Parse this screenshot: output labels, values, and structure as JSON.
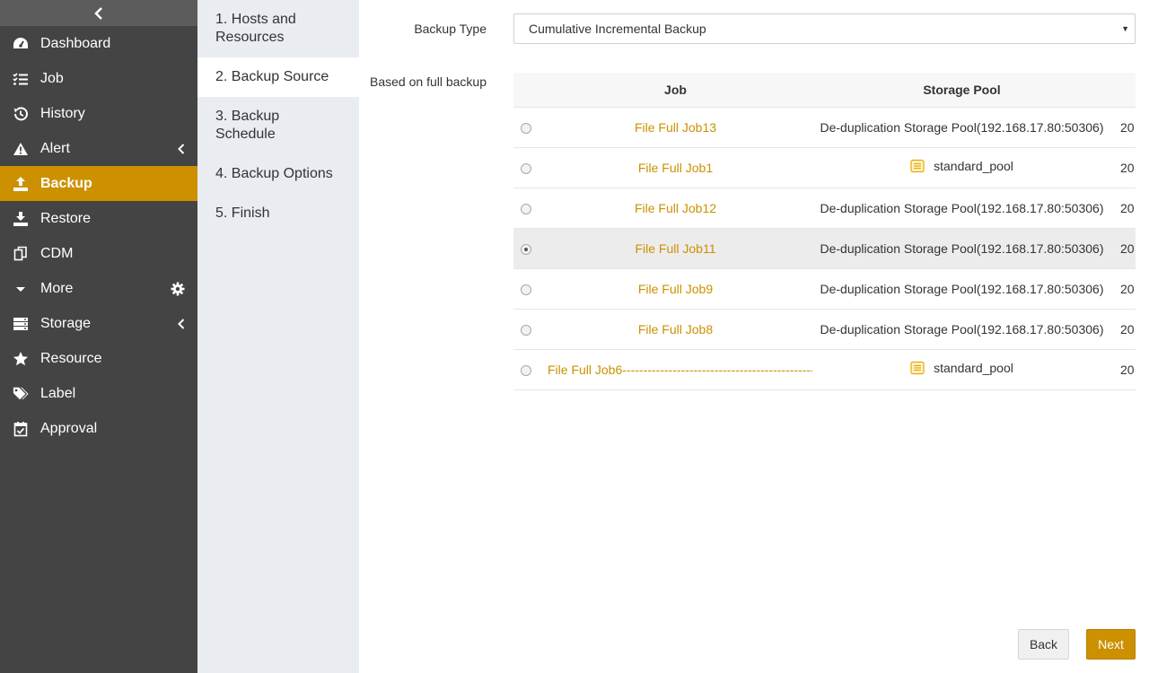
{
  "sidebar": {
    "items": [
      {
        "label": "Dashboard",
        "icon": "dashboard-icon"
      },
      {
        "label": "Job",
        "icon": "list-icon"
      },
      {
        "label": "History",
        "icon": "history-icon"
      },
      {
        "label": "Alert",
        "icon": "warning-icon"
      },
      {
        "label": "Backup",
        "icon": "upload-icon",
        "active": true
      },
      {
        "label": "Restore",
        "icon": "download-icon"
      },
      {
        "label": "CDM",
        "icon": "copy-icon"
      },
      {
        "label": "More",
        "icon": "caret-down-icon"
      },
      {
        "label": "Storage",
        "icon": "server-icon"
      },
      {
        "label": "Resource",
        "icon": "star-icon"
      },
      {
        "label": "Label",
        "icon": "tags-icon"
      },
      {
        "label": "Approval",
        "icon": "calendar-check-icon"
      }
    ]
  },
  "steps": [
    {
      "label": "1. Hosts and Resources"
    },
    {
      "label": "2. Backup Source",
      "active": true
    },
    {
      "label": "3. Backup Schedule"
    },
    {
      "label": "4. Backup Options"
    },
    {
      "label": "5. Finish"
    }
  ],
  "form": {
    "backup_type_label": "Backup Type",
    "backup_type_value": "Cumulative Incremental Backup",
    "based_on_label": "Based on full backup"
  },
  "table": {
    "headers": {
      "job": "Job",
      "pool": "Storage Pool",
      "date": ""
    },
    "rows": [
      {
        "job": "File Full Job13",
        "pool": "De-duplication Storage Pool(192.168.17.80:50306)",
        "date": "20",
        "selected": false
      },
      {
        "job": "File Full Job1",
        "pool": "standard_pool",
        "date": "20",
        "selected": false
      },
      {
        "job": "File Full Job12",
        "pool": "De-duplication Storage Pool(192.168.17.80:50306)",
        "date": "20",
        "selected": false
      },
      {
        "job": "File Full Job11",
        "pool": "De-duplication Storage Pool(192.168.17.80:50306)",
        "date": "20",
        "selected": true
      },
      {
        "job": "File Full Job9",
        "pool": "De-duplication Storage Pool(192.168.17.80:50306)",
        "date": "20",
        "selected": false
      },
      {
        "job": "File Full Job8",
        "pool": "De-duplication Storage Pool(192.168.17.80:50306)",
        "date": "20",
        "selected": false
      },
      {
        "job": "File Full Job6-----------------------------------------------",
        "pool": "standard_pool",
        "date": "20",
        "selected": false
      }
    ]
  },
  "buttons": {
    "back": "Back",
    "next": "Next"
  },
  "colors": {
    "accent": "#cc9000",
    "sidebar": "#444444",
    "steps_bg": "#e9ecf1"
  }
}
